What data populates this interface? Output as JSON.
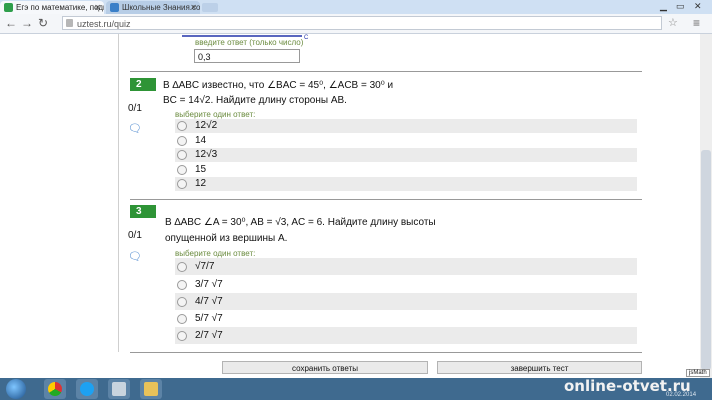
{
  "browser": {
    "tabs": [
      {
        "label": "Егэ по математике, подг"
      },
      {
        "label": "Школьные Знания.com -"
      }
    ],
    "url": "uztest.ru/quiz"
  },
  "previous_question": {
    "answer_label": "введите ответ (только число)",
    "answer_value": "0,3"
  },
  "questions": [
    {
      "number": "2",
      "score": "0/1",
      "text_line1": "В  ∆ABC  известно, что  ∠BAC = 45⁰,  ∠ACB = 30⁰  и",
      "text_line2": "BC = 14√2. Найдите длину стороны  AB.",
      "choose_label": "выберите один ответ:",
      "options": [
        "12√2",
        "14",
        "12√3",
        "15",
        "12"
      ]
    },
    {
      "number": "3",
      "score": "0/1",
      "text_line1": "В  ∆ABC   ∠A = 30⁰,  AB = √3,  AC = 6. Найдите длину высоты",
      "text_line2": "опущенной из вершины  A.",
      "choose_label": "выберите один ответ:",
      "options": [
        "√7/7",
        "3/7 √7",
        "4/7 √7",
        "5/7 √7",
        "2/7 √7"
      ]
    }
  ],
  "buttons": {
    "save": "сохранить ответы",
    "finish": "завершить тест"
  },
  "jsmath": "jsMath",
  "watermark": "online-otvet.ru",
  "tray_date": "02.02.2014",
  "colors": {
    "question_badge": "#2e9436",
    "hint_text": "#6a8b3e",
    "option_shade": "#ebebeb"
  },
  "icons": [
    "chrome-icon",
    "skype-icon",
    "calculator-icon",
    "folder-icon",
    "windows-start-icon"
  ]
}
